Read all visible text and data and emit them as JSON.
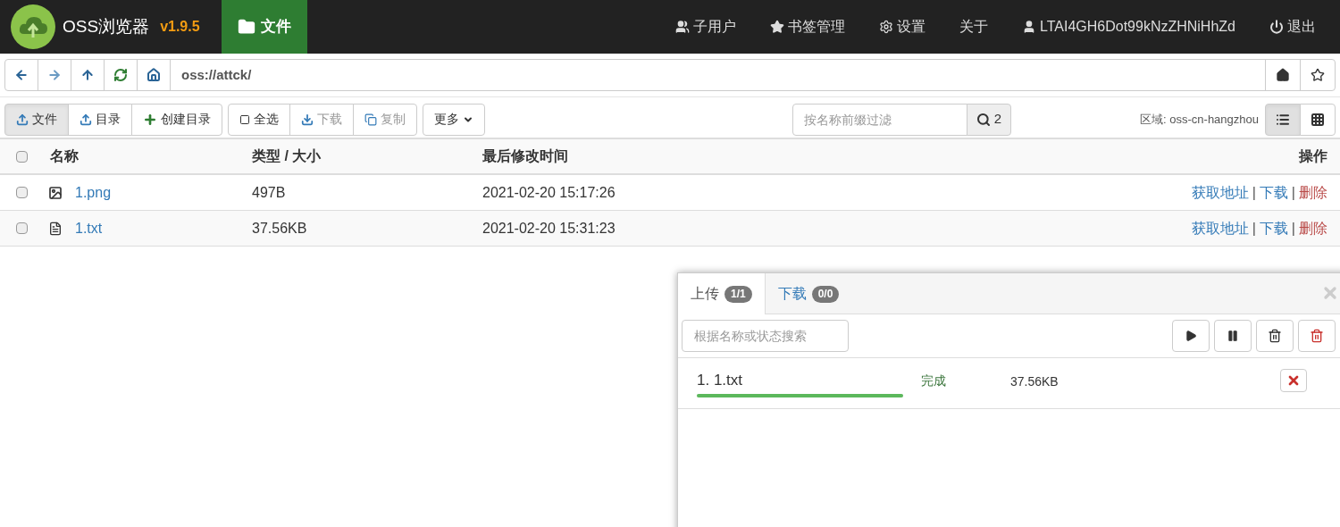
{
  "navbar": {
    "app_name": "OSS浏览器",
    "version": "v1.9.5",
    "tabs": [
      {
        "label": "文件",
        "kind": "folder",
        "selected": true
      }
    ],
    "menu": [
      {
        "label": "子用户",
        "kind": "users"
      },
      {
        "label": "书签管理",
        "kind": "star"
      },
      {
        "label": "设置",
        "kind": "gear"
      },
      {
        "label": "关于",
        "kind": "plain"
      },
      {
        "label": "LTAI4GH6Dot99kNzZHNiHhZd",
        "kind": "user"
      },
      {
        "label": "退出",
        "kind": "power"
      }
    ]
  },
  "address_bar": {
    "path": "oss://attck/"
  },
  "toolbar": {
    "groups": [
      [
        {
          "label": "文件",
          "kind": "upload",
          "pressed": true,
          "disabled": false
        },
        {
          "label": "目录",
          "kind": "upload",
          "pressed": false,
          "disabled": false
        },
        {
          "label": "创建目录",
          "kind": "plus",
          "pressed": false,
          "disabled": false
        }
      ],
      [
        {
          "label": "全选",
          "kind": "square",
          "pressed": false,
          "disabled": false
        },
        {
          "label": "下载",
          "kind": "download",
          "pressed": false,
          "disabled": true
        },
        {
          "label": "复制",
          "kind": "copy",
          "pressed": false,
          "disabled": true
        }
      ],
      [
        {
          "label": "更多",
          "kind": "caret",
          "pressed": false,
          "disabled": false
        }
      ]
    ],
    "filter": {
      "placeholder": "按名称前缀过滤",
      "count": "2"
    },
    "region": "区域: oss-cn-hangzhou",
    "view_modes": [
      {
        "kind": "list",
        "selected": true
      },
      {
        "kind": "grid",
        "selected": false
      }
    ]
  },
  "table": {
    "checked": false,
    "columns": [
      "名称",
      "类型 / 大小",
      "最后修改时间",
      "操作"
    ],
    "rows": [
      {
        "kind": "image",
        "checked": false,
        "name": "1.png",
        "size": "497B",
        "modified": "2021-02-20 15:17:26",
        "actions": [
          {
            "kind": "link",
            "label": "获取地址"
          },
          {
            "kind": "separator",
            "label": "|"
          },
          {
            "kind": "link",
            "label": "下载"
          },
          {
            "kind": "separator",
            "label": "|"
          },
          {
            "kind": "danger",
            "label": "删除"
          }
        ]
      },
      {
        "kind": "text",
        "checked": false,
        "name": "1.txt",
        "size": "37.56KB",
        "modified": "2021-02-20 15:31:23",
        "actions": [
          {
            "kind": "link",
            "label": "获取地址"
          },
          {
            "kind": "separator",
            "label": "|"
          },
          {
            "kind": "link",
            "label": "下载"
          },
          {
            "kind": "separator",
            "label": "|"
          },
          {
            "kind": "danger",
            "label": "删除"
          }
        ]
      }
    ]
  },
  "transfer_panel": {
    "tabs": [
      {
        "label": "上传",
        "count": "1/1",
        "selected": true
      },
      {
        "label": "下载",
        "count": "0/0",
        "selected": false
      }
    ],
    "search": {
      "placeholder": "根据名称或状态搜索"
    },
    "buttons": [
      {
        "kind": "play"
      },
      {
        "kind": "pause"
      },
      {
        "kind": "trash"
      },
      {
        "kind": "trash-danger"
      }
    ],
    "items": [
      {
        "name": "1. 1.txt",
        "status": "完成",
        "size": "37.56KB",
        "level": 1
      }
    ]
  }
}
